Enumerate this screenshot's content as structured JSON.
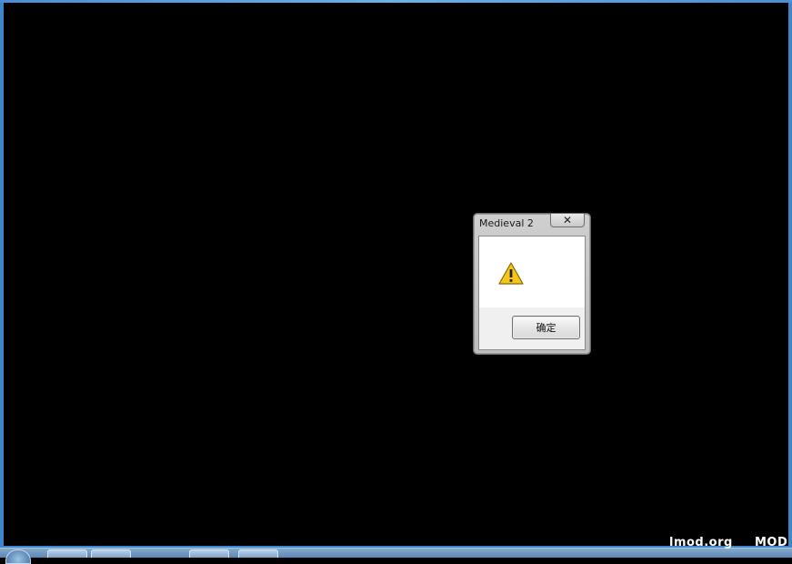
{
  "dialog": {
    "title": "Medieval 2",
    "close_glyph": "✕",
    "ok_label": "确定",
    "icon": "warning-icon"
  },
  "watermark": {
    "site": "lmod.org",
    "tag": "MOD"
  },
  "colors": {
    "window_border": "#3d86c9",
    "background": "#000000",
    "warning_yellow": "#f5c518"
  }
}
